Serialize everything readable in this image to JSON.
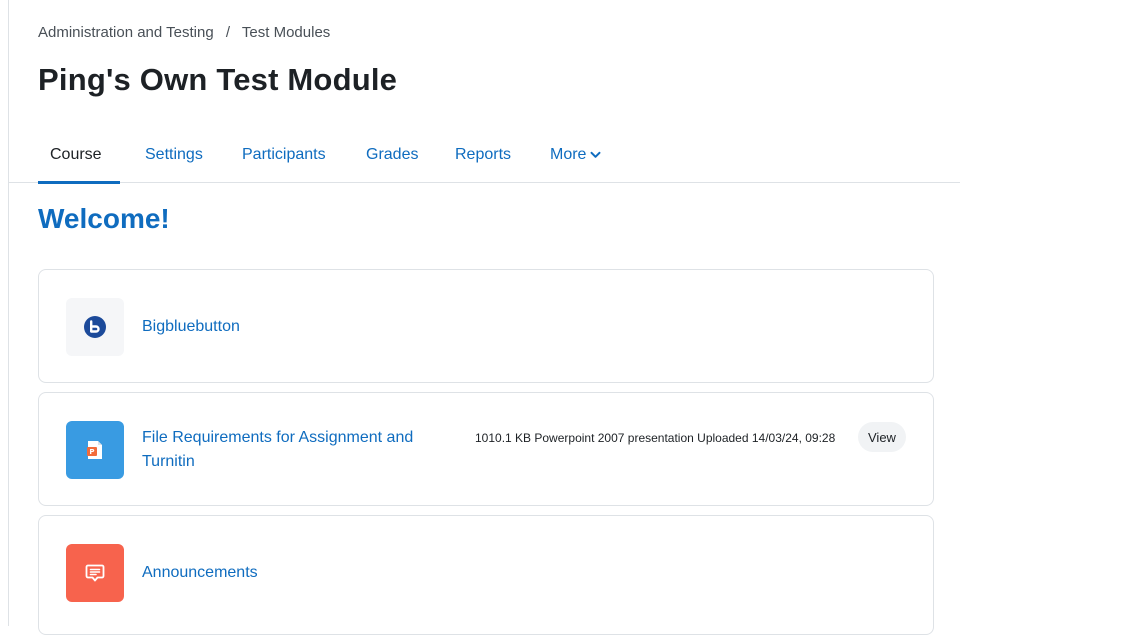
{
  "breadcrumb": {
    "items": [
      "Administration and Testing",
      "Test Modules"
    ],
    "separator": "/"
  },
  "page_title": "Ping's Own Test Module",
  "tabs": [
    {
      "label": "Course",
      "active": true
    },
    {
      "label": "Settings",
      "active": false
    },
    {
      "label": "Participants",
      "active": false
    },
    {
      "label": "Grades",
      "active": false
    },
    {
      "label": "Reports",
      "active": false
    },
    {
      "label": "More",
      "active": false
    }
  ],
  "section_title": "Welcome!",
  "activities": [
    {
      "name": "Bigbluebutton",
      "icon": "bigbluebutton-icon"
    },
    {
      "name": "File Requirements for Assignment and Turnitin",
      "icon": "powerpoint-icon",
      "meta": "1010.1 KB Powerpoint 2007 presentation Uploaded 14/03/24, 09:28",
      "action": "View"
    },
    {
      "name": "Announcements",
      "icon": "forum-icon"
    }
  ],
  "colors": {
    "link": "#0f6cbf",
    "text": "#1d2125",
    "bbb_icon_bg": "#f5f6f8",
    "bbb_icon": "#1c4a9a",
    "file_icon_bg": "#399be2",
    "forum_icon_bg": "#f7634d"
  }
}
